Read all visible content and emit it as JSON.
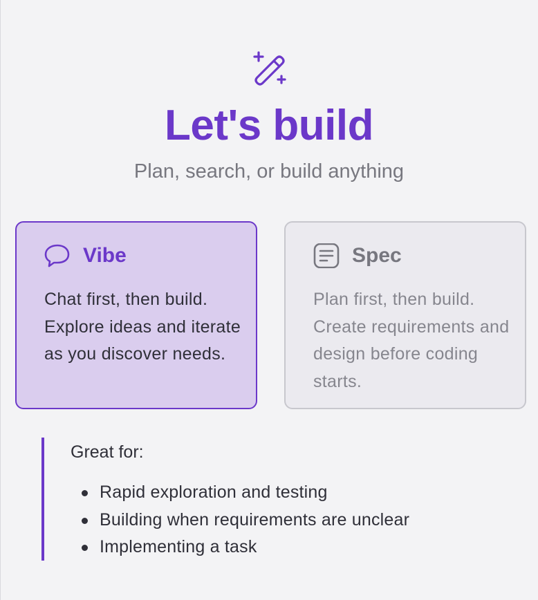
{
  "header": {
    "icon": "magic-wand-sparkles-icon",
    "title": "Let's build",
    "subtitle": "Plan, search, or build anything"
  },
  "modes": [
    {
      "id": "vibe",
      "icon": "chat-bubble-icon",
      "title": "Vibe",
      "description": "Chat first, then build. Explore ideas and iterate as you discover needs.",
      "selected": true
    },
    {
      "id": "spec",
      "icon": "document-lines-icon",
      "title": "Spec",
      "description": "Plan first, then build. Create requirements and design before coding starts.",
      "selected": false
    }
  ],
  "great_for": {
    "heading": "Great for:",
    "items": [
      "Rapid exploration and testing",
      "Building when requirements are unclear",
      "Implementing a task"
    ]
  },
  "colors": {
    "accent": "#6b38c9",
    "selected_card_bg": "#dacdee",
    "unselected_card_bg": "#ebeaef",
    "background": "#f3f3f5",
    "muted_text": "#77777f"
  }
}
